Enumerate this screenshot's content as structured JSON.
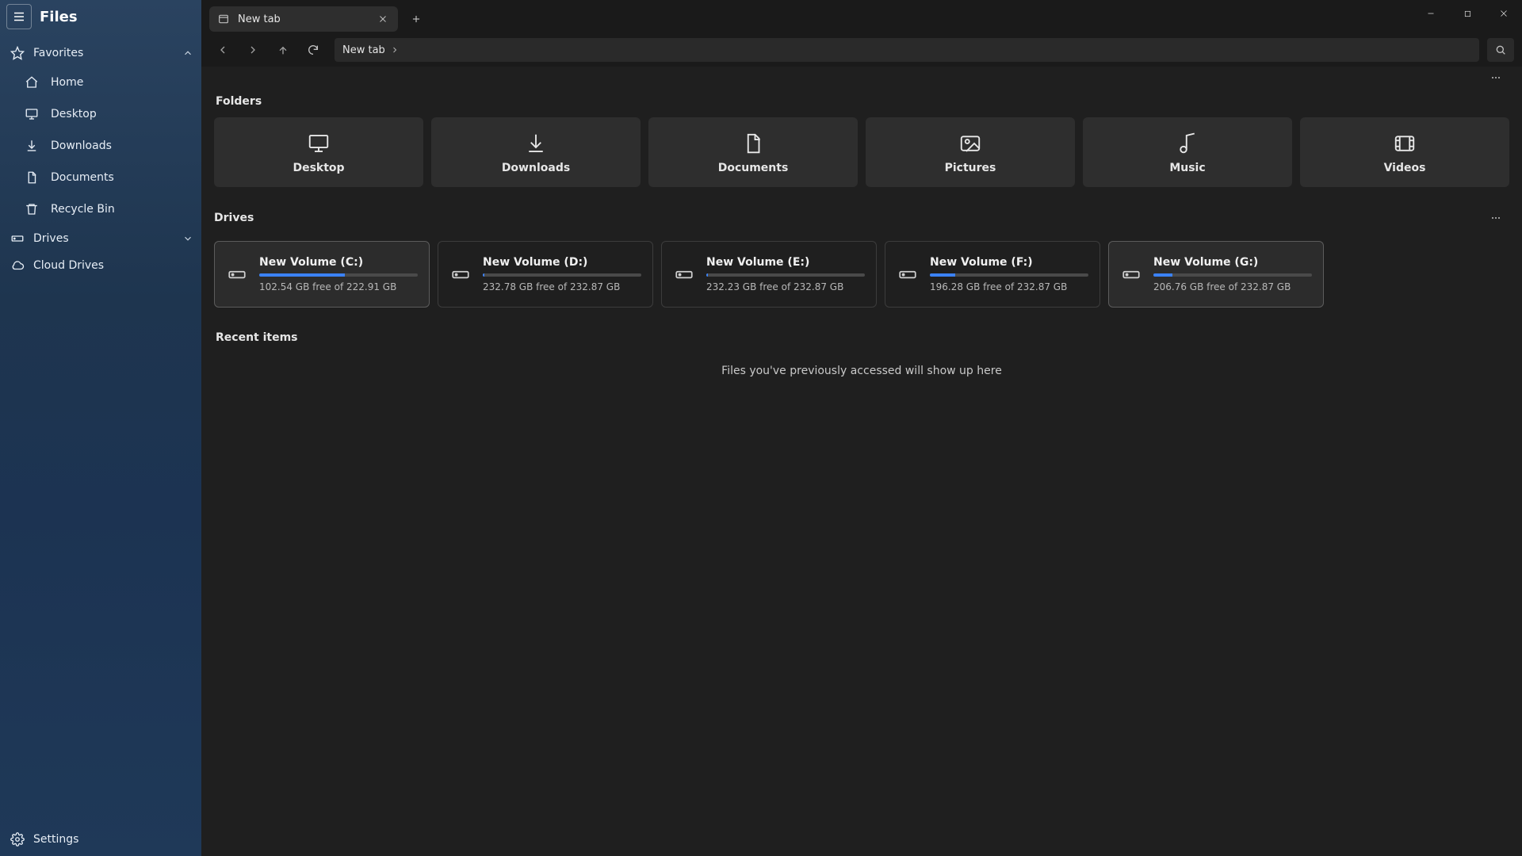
{
  "app": {
    "title": "Files"
  },
  "sidebar": {
    "favorites_label": "Favorites",
    "favorites": [
      {
        "label": "Home"
      },
      {
        "label": "Desktop"
      },
      {
        "label": "Downloads"
      },
      {
        "label": "Documents"
      },
      {
        "label": "Recycle Bin"
      }
    ],
    "drives_label": "Drives",
    "cloud_label": "Cloud Drives",
    "settings_label": "Settings"
  },
  "tabs": [
    {
      "label": "New tab"
    }
  ],
  "path": {
    "crumb": "New tab"
  },
  "sections": {
    "folders": "Folders",
    "drives": "Drives",
    "recent": "Recent items"
  },
  "folders": [
    {
      "name": "Desktop"
    },
    {
      "name": "Downloads"
    },
    {
      "name": "Documents"
    },
    {
      "name": "Pictures"
    },
    {
      "name": "Music"
    },
    {
      "name": "Videos"
    }
  ],
  "drives": [
    {
      "name": "New Volume (C:)",
      "free": "102.54 GB free of 222.91 GB",
      "percent_used": 54,
      "selected": true
    },
    {
      "name": "New Volume (D:)",
      "free": "232.78 GB free of 232.87 GB",
      "percent_used": 1,
      "selected": false
    },
    {
      "name": "New Volume (E:)",
      "free": "232.23 GB free of 232.87 GB",
      "percent_used": 1,
      "selected": false
    },
    {
      "name": "New Volume (F:)",
      "free": "196.28 GB free of 232.87 GB",
      "percent_used": 16,
      "selected": false
    },
    {
      "name": "New Volume (G:)",
      "free": "206.76 GB free of 232.87 GB",
      "percent_used": 12,
      "selected": true
    }
  ],
  "recent_empty_text": "Files you've previously accessed will show up here"
}
